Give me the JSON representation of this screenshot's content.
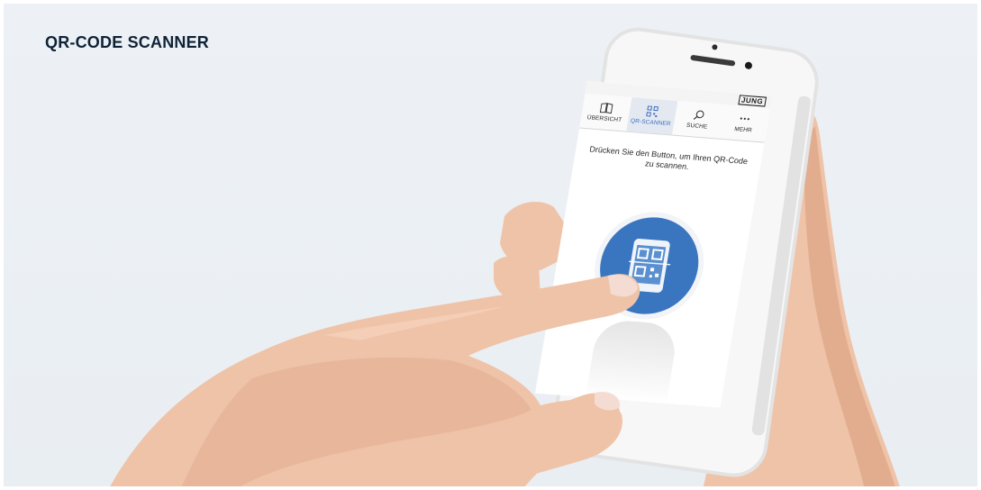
{
  "page": {
    "title": "QR-CODE SCANNER"
  },
  "app": {
    "brand": "JUNG",
    "tabs": [
      {
        "label": "ÜBERSICHT",
        "icon": "book-icon",
        "active": false
      },
      {
        "label": "QR-SCANNER",
        "icon": "qr-code-icon",
        "active": true
      },
      {
        "label": "SUCHE",
        "icon": "search-icon",
        "active": false
      },
      {
        "label": "MEHR",
        "icon": "more-dots-icon",
        "active": false
      }
    ],
    "instruction": "Drücken Sie den Button, um Ihren QR-Code zu scannen.",
    "scan_button": {
      "icon": "phone-qr-scan-icon"
    }
  },
  "colors": {
    "background": "#edf1f5",
    "title": "#0f2236",
    "accent": "#3a76c0",
    "tab_active_bg": "#e4e9f1",
    "phone_body": "#f3f3f3",
    "skin": "#efc3a8"
  }
}
